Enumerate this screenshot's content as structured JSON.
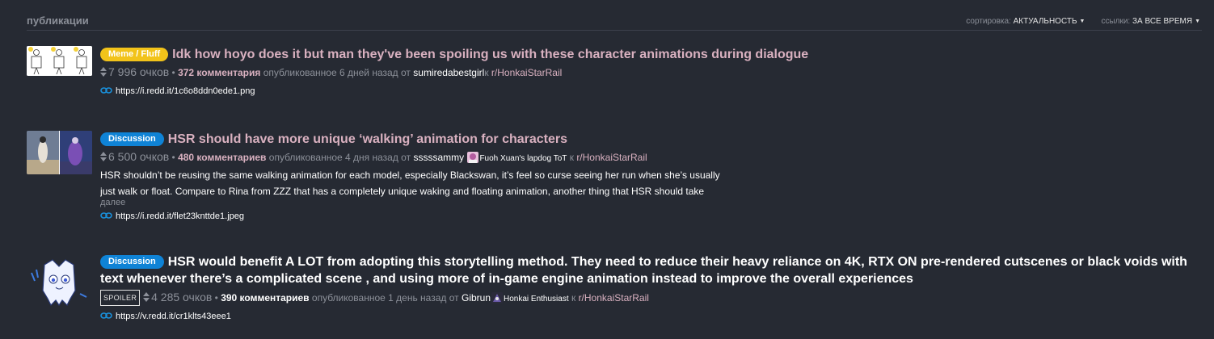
{
  "header": {
    "title": "публикации",
    "sort_label": "сортировка:",
    "sort_value": "актуальность",
    "links_label": "ссылки:",
    "links_value": "за все время",
    "caret": "▼"
  },
  "posts": [
    {
      "flair": "Meme / Fluff",
      "title": "Idk how hoyo does it but man they've been spoiling us with these character animations during dialogue",
      "score": "7 996 очков",
      "comments": "372 комментария",
      "posted": "опубликованное 6 дней назад от",
      "author": "sumiredabestgirl",
      "subreddit_prefix": "к",
      "subreddit": "r/HonkaiStarRail",
      "link": "https://i.redd.it/1c6o8ddn0ede1.png"
    },
    {
      "flair": "Discussion",
      "title": "HSR should have more unique ‘walking’ animation for characters",
      "score": "6 500 очков",
      "comments": "480 комментариев",
      "posted": "опубликованное 4 дня назад от",
      "author": "sssssammy",
      "user_flair": "Fuoh Xuan's lapdog ToT",
      "subreddit_prefix": "к",
      "subreddit": "r/HonkaiStarRail",
      "selftext": "HSR shouldn’t be reusing the same walking animation for each model, especially Blackswan, it’s feel so curse seeing her run when she’s usually just walk or float. Compare to Rina from ZZZ that has a completely unique waking and floating animation, another thing that HSR should take note from",
      "more": "далее",
      "link": "https://i.redd.it/flet23knttde1.jpeg"
    },
    {
      "flair": "Discussion",
      "title": "HSR would benefit A LOT from adopting this storytelling method. They need to reduce their heavy reliance on 4K, RTX ON pre-rendered cutscenes or black voids with text whenever there’s a complicated scene , and using more of in-game engine animation instead to improve the overall experiences",
      "spoiler": "SPOILER",
      "score": "4 285 очков",
      "comments": "390 комментариев",
      "posted": "опубликованное 1 день назад от",
      "author": "Gibrun",
      "user_flair": "Honkai Enthusiast",
      "subreddit_prefix": "к",
      "subreddit": "r/HonkaiStarRail",
      "link": "https://v.redd.it/cr1klts43eee1"
    }
  ],
  "colors": {
    "background": "#262a33",
    "title_visited": "#d9b1c0",
    "flair_meme": "#f2c31a",
    "flair_discussion": "#0f83d6",
    "link_icon": "#1a8fd9"
  },
  "icons": {
    "vote": "vote-arrows-icon",
    "link": "chain-link-icon"
  }
}
